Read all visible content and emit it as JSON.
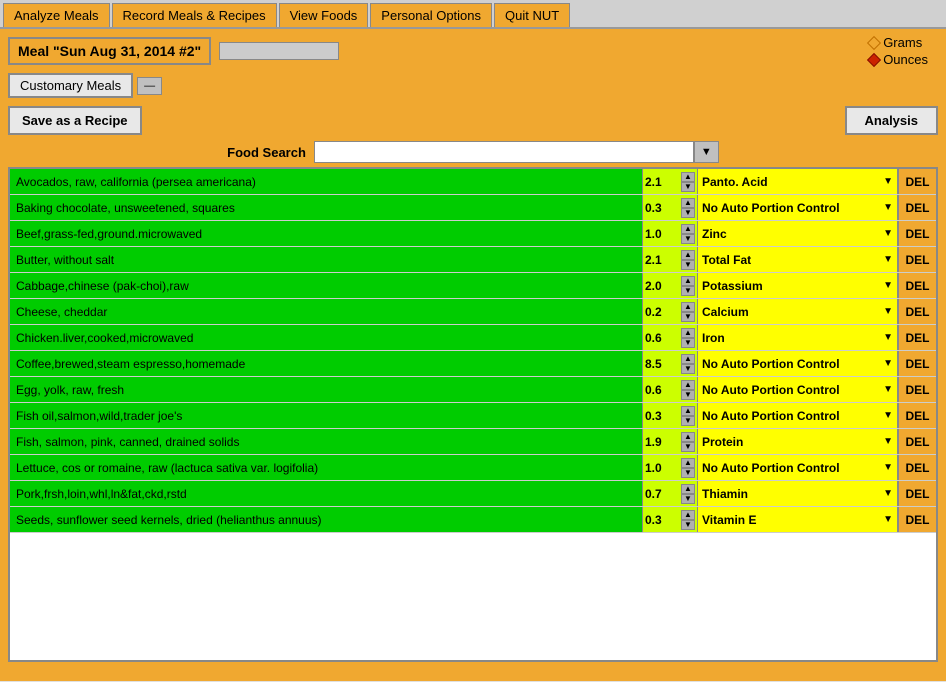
{
  "nav": {
    "tabs": [
      "Analyze Meals",
      "Record Meals & Recipes",
      "View Foods",
      "Personal Options",
      "Quit NUT"
    ]
  },
  "header": {
    "meal_title": "Meal \"Sun Aug 31, 2014 #2\"",
    "grams_label": "Grams",
    "ounces_label": "Ounces"
  },
  "customary_meals": {
    "label": "Customary Meals",
    "arrow": "—"
  },
  "actions": {
    "save_recipe": "Save as a Recipe",
    "analysis": "Analysis",
    "food_search_label": "Food Search"
  },
  "foods": [
    {
      "name": "Avocados, raw, california (persea americana)",
      "qty": "2.1",
      "nutrient": "Panto. Acid"
    },
    {
      "name": "Baking chocolate, unsweetened, squares",
      "qty": "0.3",
      "nutrient": "No Auto Portion Control"
    },
    {
      "name": "Beef,grass-fed,ground.microwaved",
      "qty": "1.0",
      "nutrient": "Zinc"
    },
    {
      "name": "Butter, without salt",
      "qty": "2.1",
      "nutrient": "Total Fat"
    },
    {
      "name": "Cabbage,chinese (pak-choi),raw",
      "qty": "2.0",
      "nutrient": "Potassium"
    },
    {
      "name": "Cheese, cheddar",
      "qty": "0.2",
      "nutrient": "Calcium"
    },
    {
      "name": "Chicken.liver,cooked,microwaved",
      "qty": "0.6",
      "nutrient": "Iron"
    },
    {
      "name": "Coffee,brewed,steam espresso,homemade",
      "qty": "8.5",
      "nutrient": "No Auto Portion Control"
    },
    {
      "name": "Egg, yolk, raw, fresh",
      "qty": "0.6",
      "nutrient": "No Auto Portion Control"
    },
    {
      "name": "Fish oil,salmon,wild,trader joe's",
      "qty": "0.3",
      "nutrient": "No Auto Portion Control"
    },
    {
      "name": "Fish, salmon, pink, canned, drained solids",
      "qty": "1.9",
      "nutrient": "Protein"
    },
    {
      "name": "Lettuce, cos or romaine, raw (lactuca sativa var. logifolia)",
      "qty": "1.0",
      "nutrient": "No Auto Portion Control"
    },
    {
      "name": "Pork,frsh,loin,whl,ln&fat,ckd,rstd",
      "qty": "0.7",
      "nutrient": "Thiamin"
    },
    {
      "name": "Seeds, sunflower seed kernels, dried (helianthus annuus)",
      "qty": "0.3",
      "nutrient": "Vitamin E"
    }
  ],
  "del_label": "DEL"
}
